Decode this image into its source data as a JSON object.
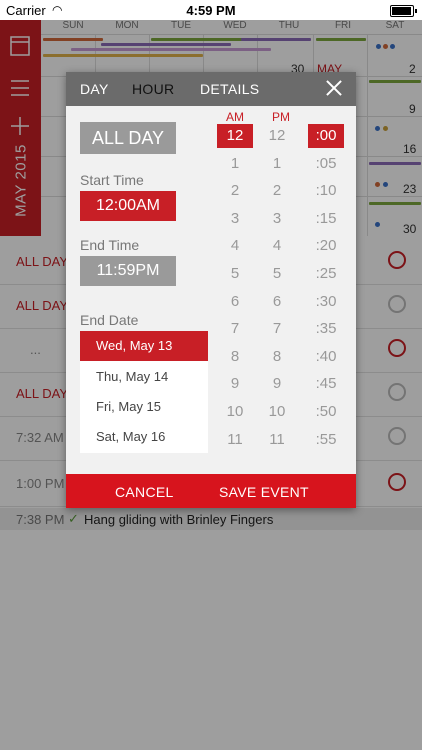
{
  "status_bar": {
    "carrier": "Carrier",
    "time": "4:59 PM"
  },
  "calendar": {
    "month_label": "MAY 2015",
    "day_headers": [
      "SUN",
      "MON",
      "TUE",
      "WED",
      "THU",
      "FRI",
      "SAT"
    ],
    "visible_dates": {
      "r0_thu": "30",
      "r0_fri": "MAY",
      "r0_sat": "2",
      "r1_sat": "9",
      "r2_sat": "16",
      "r3_sat": "23",
      "r4_sat": "30"
    }
  },
  "list": {
    "rows": [
      {
        "label": "ALL DAY",
        "style": "red",
        "alarm": "red"
      },
      {
        "label": "ALL DAY",
        "style": "red",
        "alarm": "gray"
      },
      {
        "label": "...",
        "style": "gray",
        "alarm": "red"
      },
      {
        "label": "ALL DAY",
        "style": "red",
        "alarm": "gray"
      },
      {
        "label": "7:32 AM",
        "style": "gray",
        "alarm": "gray"
      },
      {
        "label": "1:00 PM",
        "style": "gray",
        "alarm": "red"
      }
    ],
    "last_row": {
      "time": "7:38 PM",
      "check": "✓",
      "name": "Hang gliding with Brinley Fingers"
    }
  },
  "dialog": {
    "tabs": [
      "DAY",
      "HOUR",
      "DETAILS"
    ],
    "active_tab": "HOUR",
    "all_day_label": "ALL DAY",
    "start_time_label": "Start Time",
    "start_time_value": "12:00AM",
    "end_time_label": "End Time",
    "end_time_value": "11:59PM",
    "end_date_label": "End Date",
    "end_dates": [
      "Wed, May 13",
      "Thu, May 14",
      "Fri, May 15",
      "Sat, May 16"
    ],
    "selected_end_date": "Wed, May 13",
    "am_label": "AM",
    "pm_label": "PM",
    "am_hours": [
      "12",
      "1",
      "2",
      "3",
      "4",
      "5",
      "6",
      "7",
      "8",
      "9",
      "10",
      "11"
    ],
    "pm_hours": [
      "12",
      "1",
      "2",
      "3",
      "4",
      "5",
      "6",
      "7",
      "8",
      "9",
      "10",
      "11"
    ],
    "minutes": [
      ":00",
      ":05",
      ":10",
      ":15",
      ":20",
      ":25",
      ":30",
      ":35",
      ":40",
      ":45",
      ":50",
      ":55"
    ],
    "selected_am": "12",
    "selected_minute": ":00",
    "cancel_label": "CANCEL",
    "save_label": "SAVE EVENT"
  },
  "colors": {
    "accent": "#c81f26",
    "footer": "#d7141d",
    "header_gray": "#6b6b6b"
  }
}
